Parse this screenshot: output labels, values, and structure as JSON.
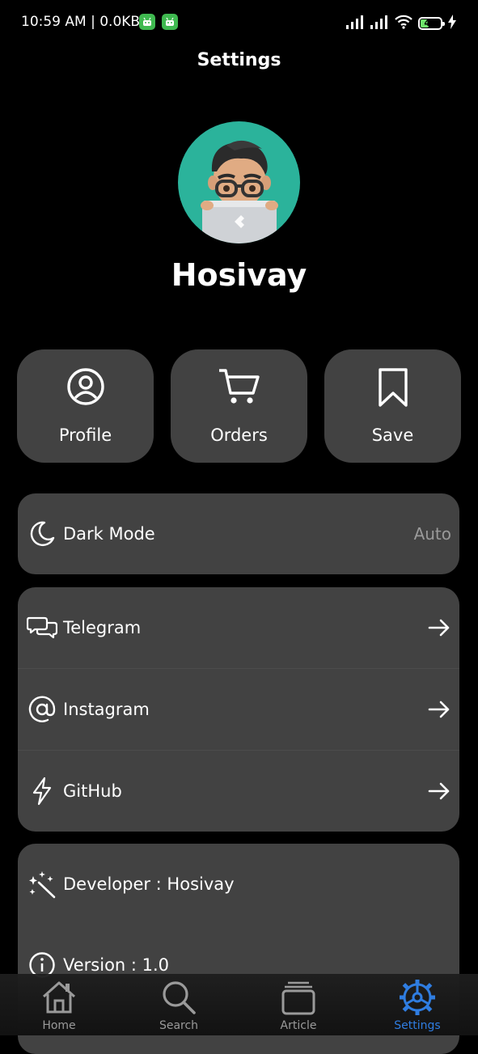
{
  "status_bar": {
    "time": "10:59 AM | 0.0KB",
    "battery_level": "42",
    "battery_percent": 42
  },
  "header": {
    "title": "Settings"
  },
  "profile": {
    "name": "Hosivay"
  },
  "quick_actions": [
    {
      "label": "Profile",
      "icon": "user-circle-icon"
    },
    {
      "label": "Orders",
      "icon": "cart-icon"
    },
    {
      "label": "Save",
      "icon": "bookmark-icon"
    }
  ],
  "appearance": {
    "label": "Dark Mode",
    "value": "Auto",
    "icon": "moon-icon"
  },
  "social_links": [
    {
      "label": "Telegram",
      "icon": "chat-bubbles-icon"
    },
    {
      "label": "Instagram",
      "icon": "at-sign-icon"
    },
    {
      "label": "GitHub",
      "icon": "lightning-icon"
    }
  ],
  "about": [
    {
      "label": "Developer : Hosivay",
      "icon": "sparkle-wand-icon"
    },
    {
      "label": "Version : 1.0",
      "icon": "info-icon"
    }
  ],
  "bottom_nav": {
    "items": [
      {
        "label": "Home",
        "icon": "home-icon"
      },
      {
        "label": "Search",
        "icon": "search-icon"
      },
      {
        "label": "Article",
        "icon": "article-stack-icon"
      },
      {
        "label": "Settings",
        "icon": "settings-gear-icon"
      }
    ],
    "active": "Settings"
  },
  "colors": {
    "background": "#000000",
    "card": "#424242",
    "accent": "#2f7de1",
    "avatar_bg": "#2bb39b"
  }
}
